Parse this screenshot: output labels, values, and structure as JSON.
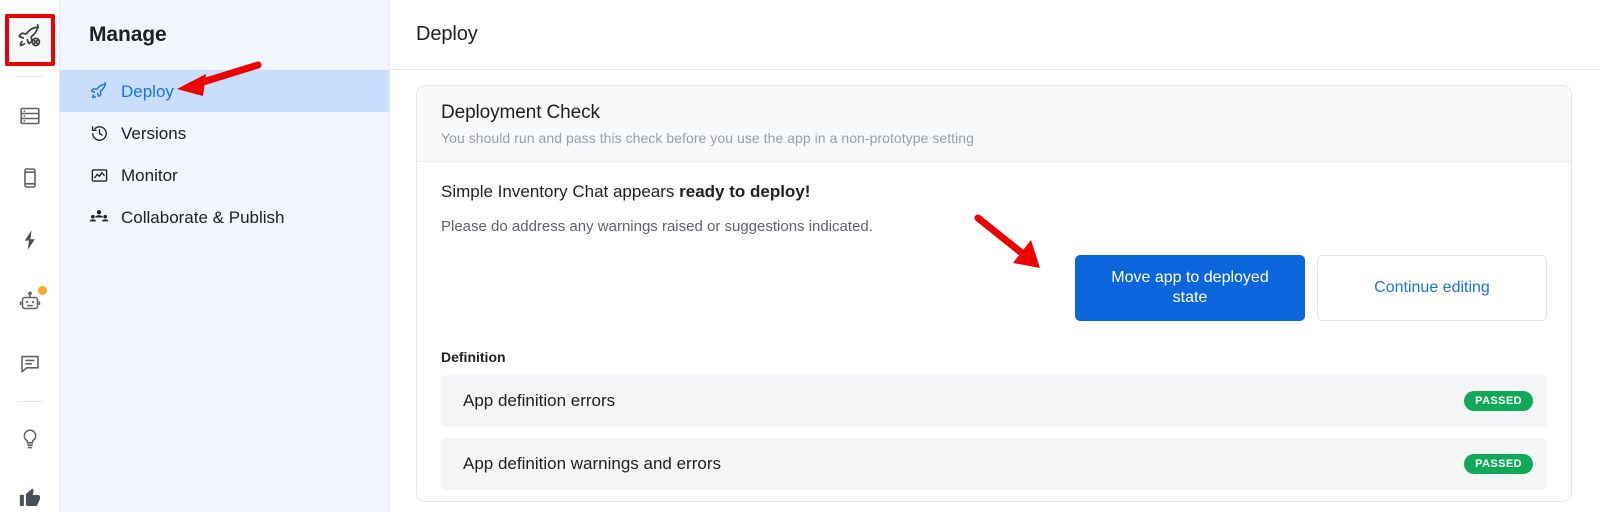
{
  "icon_rail": {
    "items": [
      {
        "name": "rocket-icon",
        "label": "Deploy",
        "active": true,
        "badge": false
      },
      {
        "name": "divider",
        "label": "",
        "active": false,
        "badge": false
      },
      {
        "name": "database-icon",
        "label": "Data",
        "active": false,
        "badge": false
      },
      {
        "name": "device-icon",
        "label": "Preview",
        "active": false,
        "badge": false
      },
      {
        "name": "lightning-icon",
        "label": "Actions",
        "active": false,
        "badge": false
      },
      {
        "name": "robot-icon",
        "label": "Agent",
        "active": false,
        "badge": true
      },
      {
        "name": "chat-icon",
        "label": "Chat",
        "active": false,
        "badge": false
      },
      {
        "name": "divider",
        "label": "",
        "active": false,
        "badge": false
      },
      {
        "name": "lightbulb-icon",
        "label": "Ideas",
        "active": false,
        "badge": false
      },
      {
        "name": "thumbs-up-icon",
        "label": "Feedback",
        "active": false,
        "badge": false
      }
    ]
  },
  "sidebar": {
    "title": "Manage",
    "items": [
      {
        "label": "Deploy",
        "icon": "rocket-icon",
        "selected": true
      },
      {
        "label": "Versions",
        "icon": "history-icon",
        "selected": false
      },
      {
        "label": "Monitor",
        "icon": "monitor-chart-icon",
        "selected": false
      },
      {
        "label": "Collaborate & Publish",
        "icon": "people-group-icon",
        "selected": false
      }
    ]
  },
  "header": {
    "title": "Deploy"
  },
  "card": {
    "title": "Deployment Check",
    "subtitle": "You should run and pass this check before you use the app in a non-prototype setting",
    "status_prefix": "Simple Inventory Chat appears ",
    "status_emphasis": "ready to deploy!",
    "status_sub": "Please do address any warnings raised or suggestions indicated.",
    "primary_button": "Move app to deployed state",
    "secondary_button": "Continue editing",
    "section_title": "Definition",
    "checks": [
      {
        "name": "App definition errors",
        "status": "PASSED"
      },
      {
        "name": "App definition warnings and errors",
        "status": "PASSED"
      }
    ]
  },
  "colors": {
    "accent_blue": "#0b66de",
    "link_blue": "#1a73e8",
    "selected_nav": "#c9ddfc",
    "sidebar_bg": "#f3f6fc",
    "pass_green": "#0fa958",
    "annotation_red": "#ef0000",
    "badge_orange": "#f9a825"
  },
  "annotations": {
    "rocket_highlight": "red-box-around-rocket-rail-icon",
    "arrow_to_deploy": "red-arrow-pointing-left-at-deploy-nav-item",
    "arrow_to_primary_button": "red-arrow-pointing-down-right-at-move-app-to-deployed-state-button"
  }
}
